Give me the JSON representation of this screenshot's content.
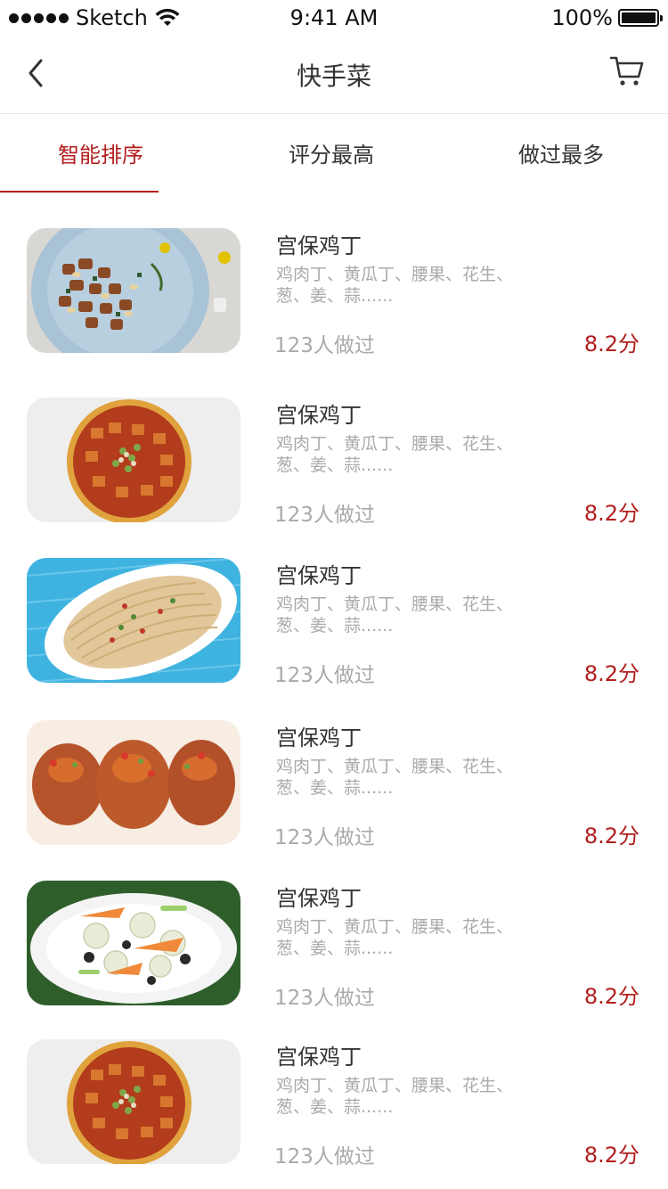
{
  "status_bar": {
    "carrier": "Sketch",
    "time": "9:41 AM",
    "battery": "100%"
  },
  "nav": {
    "title": "快手菜"
  },
  "tabs": [
    {
      "label": "智能排序",
      "active": true
    },
    {
      "label": "评分最高",
      "active": false
    },
    {
      "label": "做过最多",
      "active": false
    }
  ],
  "recipes": [
    {
      "title": "宫保鸡丁",
      "desc": "鸡肉丁、黄瓜丁、腰果、花生、葱、姜、蒜......",
      "count": "123人做过",
      "score": "8.2分",
      "image": "kungpao-chicken"
    },
    {
      "title": "宫保鸡丁",
      "desc": "鸡肉丁、黄瓜丁、腰果、花生、葱、姜、蒜......",
      "count": "123人做过",
      "score": "8.2分",
      "image": "mapo-tofu-bowl"
    },
    {
      "title": "宫保鸡丁",
      "desc": "鸡肉丁、黄瓜丁、腰果、花生、葱、姜、蒜......",
      "count": "123人做过",
      "score": "8.2分",
      "image": "noodles-plate"
    },
    {
      "title": "宫保鸡丁",
      "desc": "鸡肉丁、黄瓜丁、腰果、花生、葱、姜、蒜......",
      "count": "123人做过",
      "score": "8.2分",
      "image": "chicken-wings"
    },
    {
      "title": "宫保鸡丁",
      "desc": "鸡肉丁、黄瓜丁、腰果、花生、葱、姜、蒜......",
      "count": "123人做过",
      "score": "8.2分",
      "image": "lotus-stir-fry"
    },
    {
      "title": "宫保鸡丁",
      "desc": "鸡肉丁、黄瓜丁、腰果、花生、葱、姜、蒜......",
      "count": "123人做过",
      "score": "8.2分",
      "image": "mapo-tofu-bowl"
    }
  ],
  "colors": {
    "accent": "#b21f1f",
    "muted_text": "#aaaaaa",
    "divider": "#e6e6e6"
  }
}
